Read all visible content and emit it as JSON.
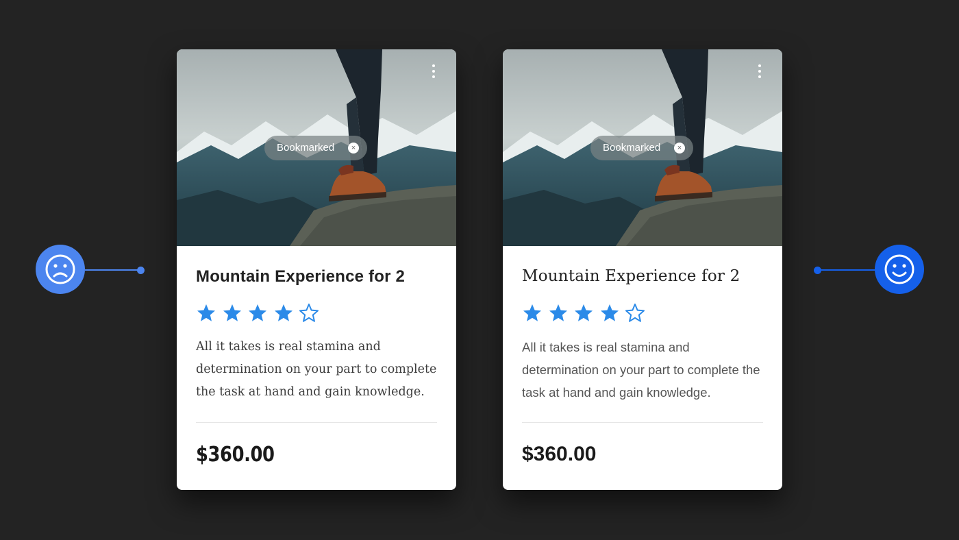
{
  "colors": {
    "background": "#232323",
    "star_blue": "#2b8ae8",
    "sad_accent": "#4c85ef",
    "happy_accent": "#1560ea"
  },
  "cards": [
    {
      "variant": "before",
      "chip_label": "Bookmarked",
      "chip_close_icon": "×",
      "title": "Mountain Experience for 2",
      "rating": 4,
      "rating_max": 5,
      "description": "All it takes is real stamina and determination on your part to complete the task at hand and gain knowledge.",
      "price": "$360.00"
    },
    {
      "variant": "after",
      "chip_label": "Bookmarked",
      "chip_close_icon": "×",
      "title": "Mountain Experience for 2",
      "rating": 4,
      "rating_max": 5,
      "description": "All it takes is real stamina and determination on your part to complete the task at hand and gain knowledge.",
      "price": "$360.00"
    }
  ],
  "indicators": {
    "left": "sad-face-icon",
    "right": "happy-face-icon"
  }
}
